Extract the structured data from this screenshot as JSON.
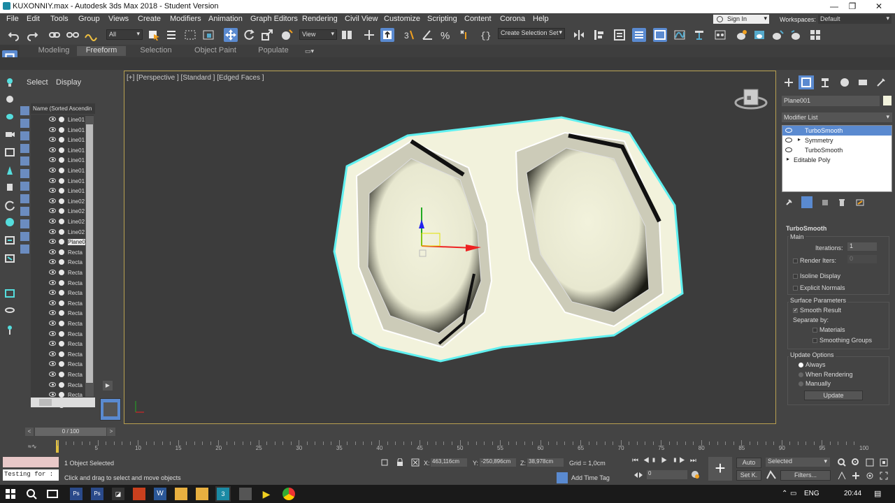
{
  "window": {
    "title": "KUXONNIY.max - Autodesk 3ds Max 2018 - Student Version"
  },
  "menu": [
    "File",
    "Edit",
    "Tools",
    "Group",
    "Views",
    "Create",
    "Modifiers",
    "Animation",
    "Graph Editors",
    "Rendering",
    "Civil View",
    "Customize",
    "Scripting",
    "Content",
    "Corona",
    "Help"
  ],
  "account": {
    "signin": "Sign In",
    "workspaces_label": "Workspaces:",
    "workspace": "Default"
  },
  "toolbar": {
    "filter": "All",
    "refcoord": "View",
    "selection_set": "Create Selection Set"
  },
  "ribbon": {
    "tabs": [
      "Modeling",
      "Freeform",
      "Selection",
      "Object Paint",
      "Populate"
    ],
    "active": 1
  },
  "scene_explorer": {
    "tabs": [
      "Select",
      "Display"
    ],
    "column_header": "Name (Sorted Ascendin",
    "rows": [
      "Line01",
      "Line01",
      "Line01",
      "Line01",
      "Line01",
      "Line01",
      "Line01",
      "Line01",
      "Line02",
      "Line02",
      "Line02",
      "Line02",
      "Plane0",
      "Recta",
      "Recta",
      "Recta",
      "Recta",
      "Recta",
      "Recta",
      "Recta",
      "Recta",
      "Recta",
      "Recta",
      "Recta",
      "Recta",
      "Recta",
      "Recta",
      "Recta",
      "Recta"
    ],
    "selected_index": 12
  },
  "viewport": {
    "label": "[+] [Perspective ] [Standard ] [Edged Faces ]"
  },
  "command_panel": {
    "object_name": "Plane001",
    "modifier_list": "Modifier List",
    "stack": [
      "TurboSmooth",
      "Symmetry",
      "TurboSmooth",
      "Editable Poly"
    ],
    "stack_selected": 0,
    "rollout_title": "TurboSmooth",
    "main_label": "Main",
    "iterations_label": "Iterations:",
    "iterations_value": "1",
    "render_iters_label": "Render Iters:",
    "render_iters_value": "0",
    "isoline": "Isoline Display",
    "explicit_normals": "Explicit Normals",
    "surface_params": "Surface Parameters",
    "smooth_result": "Smooth Result",
    "separate_by": "Separate by:",
    "materials": "Materials",
    "smoothing_groups": "Smoothing Groups",
    "update_options": "Update Options",
    "always": "Always",
    "when_rendering": "When Rendering",
    "manually": "Manually",
    "update_button": "Update"
  },
  "timeline": {
    "frame": "0 / 100",
    "ticks": [
      "0",
      "5",
      "10",
      "15",
      "20",
      "25",
      "30",
      "35",
      "40",
      "45",
      "50",
      "55",
      "60",
      "65",
      "70",
      "75",
      "80",
      "85",
      "90",
      "95",
      "100"
    ]
  },
  "status": {
    "script_listener": "Testing for :",
    "selected": "1 Object Selected",
    "prompt": "Click and drag to select and move objects",
    "x": "463,116cm",
    "y": "-250,896cm",
    "z": "38,978cm",
    "grid": "Grid = 1,0cm",
    "add_time_tag": "Add Time Tag",
    "auto": "Auto",
    "set_key": "Set K.",
    "key_filter": "Selected",
    "filters": "Filters...",
    "frame_field": "0"
  },
  "taskbar": {
    "lang": "ENG",
    "time": "20:44"
  },
  "colors": {
    "selection": "#5a8ad0",
    "viewport_border": "#b8a050",
    "mesh": "#f2f2dc",
    "mesh_edge": "#5ff0f0"
  }
}
